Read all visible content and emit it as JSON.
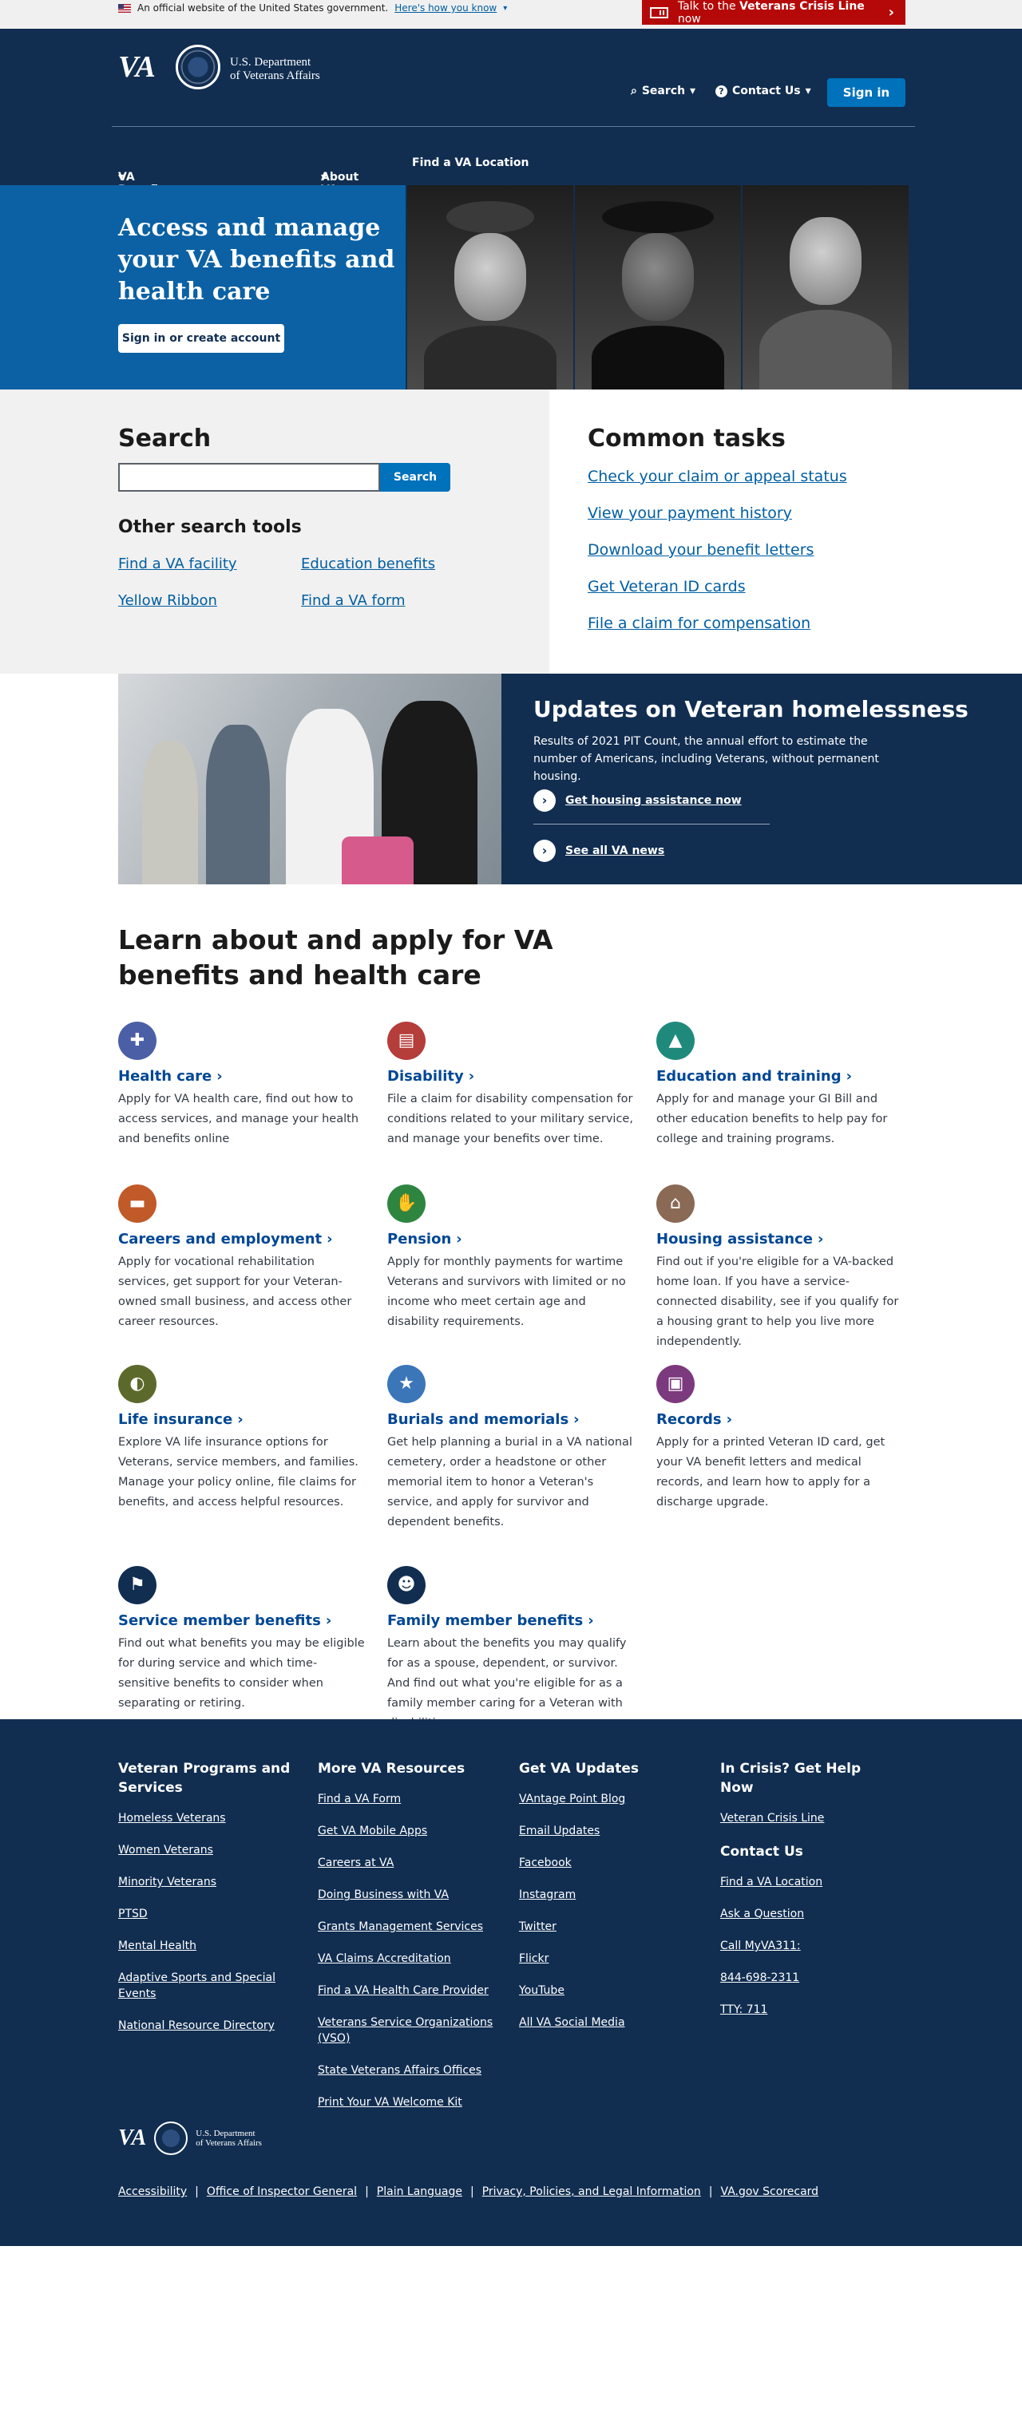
{
  "gov_banner": {
    "text": "An official website of the United States government.",
    "how_link": "Here's how you know"
  },
  "crisis": {
    "prefix": "Talk to the ",
    "strong": "Veterans Crisis Line",
    "suffix": " now"
  },
  "header": {
    "logo": "VA",
    "dept_line1": "U.S. Department",
    "dept_line2": "of Veterans Affairs",
    "search": "Search",
    "contact": "Contact Us",
    "signin": "Sign in"
  },
  "nav": [
    "VA Benefits and Health Care",
    "About VA",
    "Find a VA Location"
  ],
  "hero": {
    "title": "Access and manage your VA benefits and health care",
    "button": "Sign in or create account"
  },
  "search": {
    "title": "Search",
    "button": "Search",
    "other_title": "Other search tools",
    "tools": [
      "Find a VA facility",
      "Education benefits",
      "Yellow Ribbon",
      "Find a VA form"
    ]
  },
  "common_tasks": {
    "title": "Common tasks",
    "items": [
      "Check your claim or appeal status",
      "View your payment history",
      "Download your benefit letters",
      "Get Veteran ID cards",
      "File a claim for compensation"
    ]
  },
  "update": {
    "title": "Updates on Veteran homelessness",
    "body": "Results of 2021 PIT Count, the annual effort to estimate the number of Americans, including Veterans, without permanent housing.",
    "link1": "Get housing assistance now",
    "link2": "See all VA news"
  },
  "benefits": {
    "title": "Learn about and apply for VA benefits and health care",
    "items": [
      {
        "title": "Health care",
        "desc": "Apply for VA health care, find out how to access services, and manage your health and benefits online",
        "color": "#4a5fa5",
        "icon": "medkit-icon"
      },
      {
        "title": "Disability",
        "desc": "File a claim for disability compensation for conditions related to your military service, and manage your benefits over time.",
        "color": "#b53d3a",
        "icon": "document-icon"
      },
      {
        "title": "Education and training",
        "desc": "Apply for and manage your GI Bill and other education benefits to help pay for college and training programs.",
        "color": "#1f8a7c",
        "icon": "graduation-cap-icon"
      },
      {
        "title": "Careers and employment",
        "desc": "Apply for vocational rehabilitation services, get support for your Veteran-owned small business, and access other career resources.",
        "color": "#c05a28",
        "icon": "briefcase-icon"
      },
      {
        "title": "Pension",
        "desc": "Apply for monthly payments for wartime Veterans and survivors with limited or no income who meet certain age and disability requirements.",
        "color": "#2e8540",
        "icon": "handshake-icon"
      },
      {
        "title": "Housing assistance",
        "desc": "Find out if you're eligible for a VA-backed home loan. If you have a service-connected disability, see if you qualify for a housing grant to help you live more independently.",
        "color": "#8a6a55",
        "icon": "home-icon"
      },
      {
        "title": "Life insurance",
        "desc": "Explore VA life insurance options for Veterans, service members, and families. Manage your policy online, file claims for benefits, and access helpful resources.",
        "color": "#5b6a2a",
        "icon": "shield-icon"
      },
      {
        "title": "Burials and memorials",
        "desc": "Get help planning a burial in a VA national cemetery, order a headstone or other memorial item to honor a Veteran's service, and apply for survivor and dependent benefits.",
        "color": "#3a76b8",
        "icon": "star-icon"
      },
      {
        "title": "Records",
        "desc": "Apply for a printed Veteran ID card, get your VA benefit letters and medical records, and learn how to apply for a discharge upgrade.",
        "color": "#7b3a7d",
        "icon": "id-card-icon"
      },
      {
        "title": "Service member benefits",
        "desc": "Find out what benefits you may be eligible for during service and which time-sensitive benefits to consider when separating or retiring.",
        "color": "#112e51",
        "icon": "flag-icon"
      },
      {
        "title": "Family member benefits",
        "desc": "Learn about the benefits you may qualify for as a spouse, dependent, or survivor. And find out what you're eligible for as a family member caring for a Veteran with disabilities.",
        "color": "#112e51",
        "icon": "family-icon"
      }
    ]
  },
  "footer": {
    "columns": [
      {
        "title": "Veteran Programs and Services",
        "links": [
          "Homeless Veterans",
          "Women Veterans",
          "Minority Veterans",
          "PTSD",
          "Mental Health",
          "Adaptive Sports and Special Events",
          "National Resource Directory"
        ]
      },
      {
        "title": "More VA Resources",
        "links": [
          "Find a VA Form",
          "Get VA Mobile Apps",
          "Careers at VA",
          "Doing Business with VA",
          "Grants Management Services",
          "VA Claims Accreditation",
          "Find a VA Health Care Provider",
          "Veterans Service Organizations (VSO)",
          "State Veterans Affairs Offices",
          "Print Your VA Welcome Kit"
        ]
      },
      {
        "title": "Get VA Updates",
        "links": [
          "VAntage Point Blog",
          "Email Updates",
          "Facebook",
          "Instagram",
          "Twitter",
          "Flickr",
          "YouTube",
          "All VA Social Media"
        ]
      }
    ],
    "crisis_title": "In Crisis? Get Help Now",
    "crisis_link": "Veteran Crisis Line",
    "contact_title": "Contact Us",
    "contact_links": [
      "Find a VA Location",
      "Ask a Question",
      "Call MyVA311:",
      "844-698-2311",
      "TTY: 711"
    ],
    "logo": "VA",
    "dept_line1": "U.S. Department",
    "dept_line2": "of Veterans Affairs",
    "bottom_links": [
      "Accessibility",
      "Office of Inspector General",
      "Plain Language",
      "Privacy, Policies, and Legal Information",
      "VA.gov Scorecard"
    ]
  }
}
